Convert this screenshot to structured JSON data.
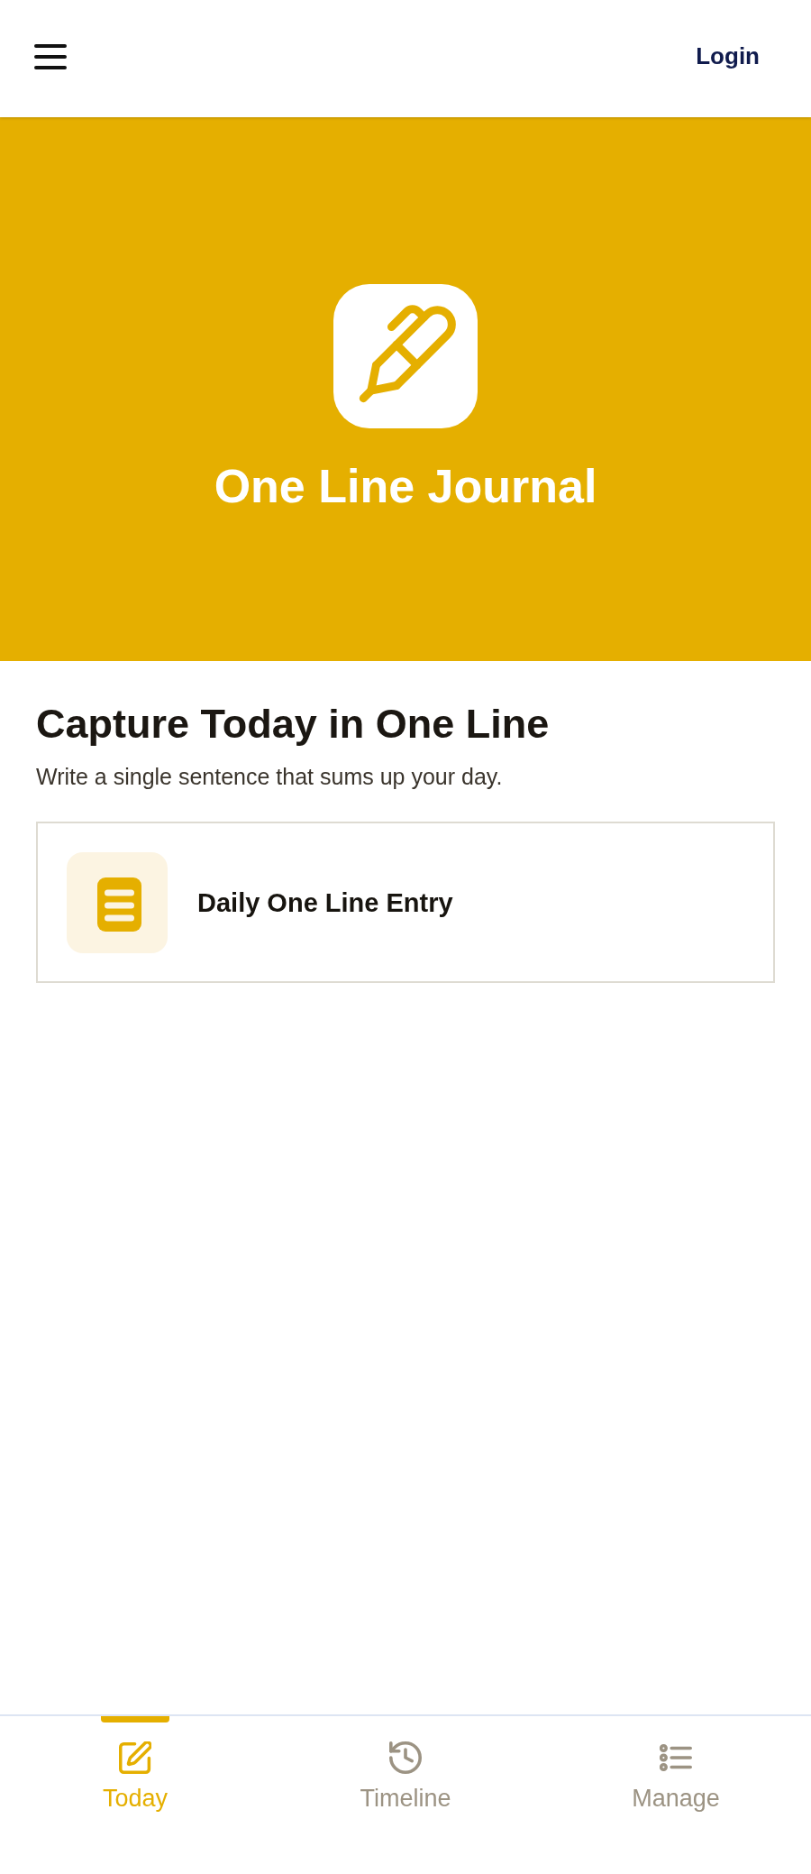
{
  "header": {
    "login": "Login"
  },
  "hero": {
    "title": "One Line Journal"
  },
  "intro": {
    "heading": "Capture Today in One Line",
    "subtitle": "Write a single sentence that sums up your day."
  },
  "entries": [
    {
      "title": "Daily One Line Entry"
    }
  ],
  "bottom_nav": [
    {
      "label": "Today",
      "kind": "edit",
      "selected": true
    },
    {
      "label": "Timeline",
      "kind": "history",
      "selected": false
    },
    {
      "label": "Manage",
      "kind": "list",
      "selected": false
    }
  ]
}
